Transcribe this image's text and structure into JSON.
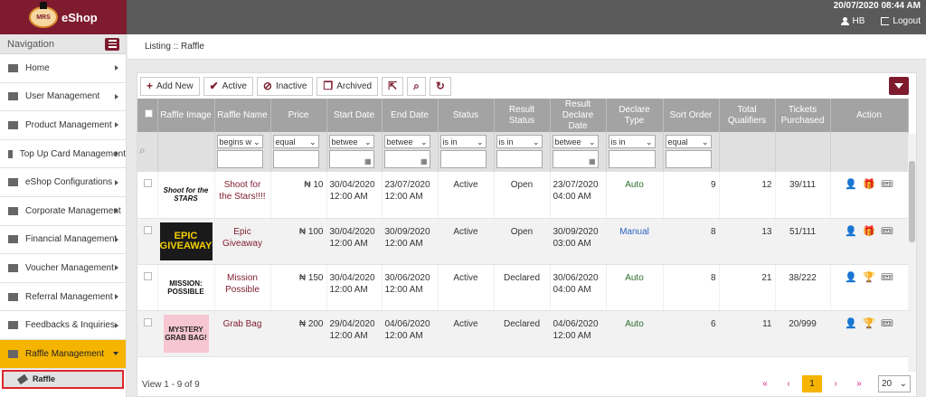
{
  "app": {
    "logo_text": "MRS",
    "name": "eShop",
    "datetime": "20/07/2020 08:44 AM",
    "user": "HB",
    "logout": "Logout"
  },
  "nav": {
    "title": "Navigation",
    "items": [
      {
        "label": "Home"
      },
      {
        "label": "User Management"
      },
      {
        "label": "Product Management"
      },
      {
        "label": "Top Up Card Management"
      },
      {
        "label": "eShop Configurations"
      },
      {
        "label": "Corporate Management"
      },
      {
        "label": "Financial Management"
      },
      {
        "label": "Voucher Management"
      },
      {
        "label": "Referral Management"
      },
      {
        "label": "Feedbacks & Inquiries"
      },
      {
        "label": "Raffle Management"
      }
    ],
    "sub_item": "Raffle"
  },
  "breadcrumb": "Listing :: Raffle",
  "toolbar": {
    "add": "Add New",
    "active": "Active",
    "inactive": "Inactive",
    "archived": "Archived"
  },
  "columns": [
    "Raffle Image",
    "Raffle Name",
    "Price",
    "Start Date",
    "End Date",
    "Status",
    "Result Status",
    "Result Declare Date",
    "Declare Type",
    "Sort Order",
    "Total Qualifiers",
    "Tickets Purchased",
    "Action"
  ],
  "filters": [
    "begins w",
    "equal",
    "betwee",
    "betwee",
    "is in",
    "is in",
    "betwee",
    "is in",
    "equal"
  ],
  "rows": [
    {
      "image_text": "Shoot for the STARS",
      "name": "Shoot for the Stars!!!!",
      "price": "₦ 10",
      "start": "30/04/2020 12:00 AM",
      "end": "23/07/2020 12:00 AM",
      "status": "Active",
      "result_status": "Open",
      "declare_date": "23/07/2020 04:00 AM",
      "declare_type": "Auto",
      "sort": "9",
      "qualifiers": "12",
      "tickets": "39/111"
    },
    {
      "image_text": "EPIC GIVEAWAY",
      "name": "Epic Giveaway",
      "price": "₦ 100",
      "start": "30/04/2020 12:00 AM",
      "end": "30/09/2020 12:00 AM",
      "status": "Active",
      "result_status": "Open",
      "declare_date": "30/09/2020 03:00 AM",
      "declare_type": "Manual",
      "sort": "8",
      "qualifiers": "13",
      "tickets": "51/111"
    },
    {
      "image_text": "MISSION: POSSIBLE",
      "name": "Mission Possible",
      "price": "₦ 150",
      "start": "30/04/2020 12:00 AM",
      "end": "30/06/2020 12:00 AM",
      "status": "Active",
      "result_status": "Declared",
      "declare_date": "30/06/2020 04:00 AM",
      "declare_type": "Auto",
      "sort": "8",
      "qualifiers": "21",
      "tickets": "38/222"
    },
    {
      "image_text": "MYSTERY GRAB BAG!",
      "name": "Grab Bag",
      "price": "₦ 200",
      "start": "29/04/2020 12:00 AM",
      "end": "04/06/2020 12:00 AM",
      "status": "Active",
      "result_status": "Declared",
      "declare_date": "04/06/2020 12:00 AM",
      "declare_type": "Auto",
      "sort": "6",
      "qualifiers": "11",
      "tickets": "20/999"
    }
  ],
  "footer": {
    "view": "View 1 - 9 of 9",
    "first": "«",
    "prev": "‹",
    "page": "1",
    "next": "›",
    "last": "»",
    "per_page": "20"
  },
  "colors": {
    "brand": "#7e1b2e",
    "active_nav": "#f5b400",
    "header_bg": "#a3a3a3"
  },
  "icons": [
    "home-icon",
    "users-icon",
    "product-icon",
    "card-icon",
    "gear-icon",
    "chart-icon",
    "finance-icon",
    "voucher-icon",
    "share-icon",
    "feedback-icon",
    "ticket-icon",
    "search-icon",
    "refresh-icon",
    "export-icon",
    "filter-icon",
    "user-icon",
    "gift-icon",
    "trophy-icon"
  ]
}
